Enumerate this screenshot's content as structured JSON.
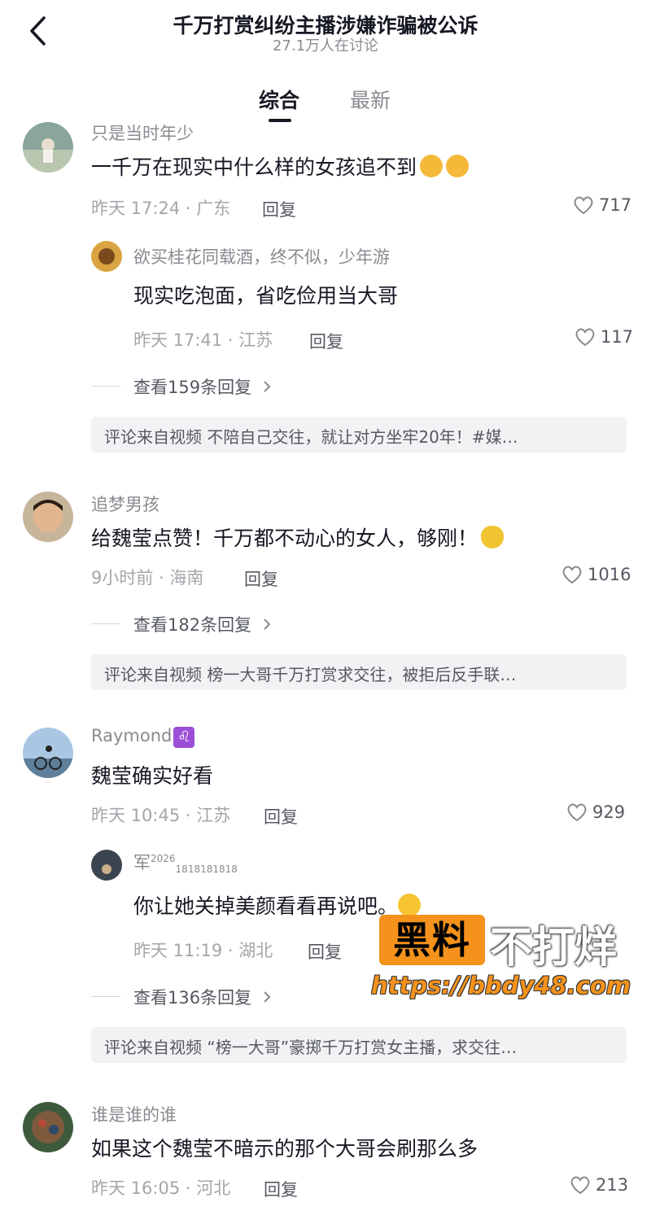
{
  "header": {
    "title": "千万打赏纠纷主播涉嫌诈骗被公诉",
    "subtitle": "27.1万人在讨论",
    "back_icon": "chevron-left-icon"
  },
  "tabs": [
    {
      "label": "综合",
      "active": true
    },
    {
      "label": "最新",
      "active": false
    }
  ],
  "comments": [
    {
      "username": "只是当时年少",
      "text": "一千万在现实中什么样的女孩追不到",
      "emojis": [
        "kiss-emoji",
        "kiss-emoji"
      ],
      "meta": "昨天 17:24 · 广东",
      "reply_label": "回复",
      "likes": "717",
      "sub_reply": {
        "username": "欲买桂花同载酒，终不似，少年游",
        "text": "现实吃泡面，省吃俭用当大哥",
        "meta": "昨天 17:41 · 江苏",
        "reply_label": "回复",
        "likes": "117"
      },
      "more_replies": "查看159条回复",
      "source": "评论来自视频  不陪自己交往，就让对方坐牢20年！#媒…"
    },
    {
      "username": "追梦男孩",
      "text": "给魏莹点赞！千万都不动心的女人，够刚！",
      "emojis": [
        "gourd-emoji"
      ],
      "meta": "9小时前 · 海南",
      "reply_label": "回复",
      "likes": "1016",
      "more_replies": "查看182条回复",
      "source": "评论来自视频  榜一大哥千万打赏求交往，被拒后反手联…"
    },
    {
      "username": "Raymond",
      "username_badge": "♌",
      "text": "魏莹确实好看",
      "meta": "昨天 10:45 · 江苏",
      "reply_label": "回复",
      "likes": "929",
      "sub_reply": {
        "username": "军",
        "username_sup": "2026",
        "username_sub": "1818181818",
        "text": "你让她关掉美颜看看再说吧。",
        "emojis": [
          "laugh-cry-emoji"
        ],
        "meta": "昨天 11:19 · 湖北",
        "reply_label": "回复"
      },
      "more_replies": "查看136条回复",
      "source": "评论来自视频  “榜一大哥”豪掷千万打赏女主播，求交往…"
    },
    {
      "username": "谁是谁的谁",
      "text": "如果这个魏莹不暗示的那个大哥会刷那么多",
      "meta": "昨天 16:05 · 河北",
      "reply_label": "回复",
      "likes": "213"
    }
  ],
  "watermark": {
    "box_text": "黑料",
    "text": "不打烊",
    "url": "https://bbdy48.com"
  },
  "colors": {
    "primary_text": "#161823",
    "secondary_text": "#8a8b91",
    "watermark_orange": "#f4921c",
    "source_bg": "#f2f2f4"
  }
}
